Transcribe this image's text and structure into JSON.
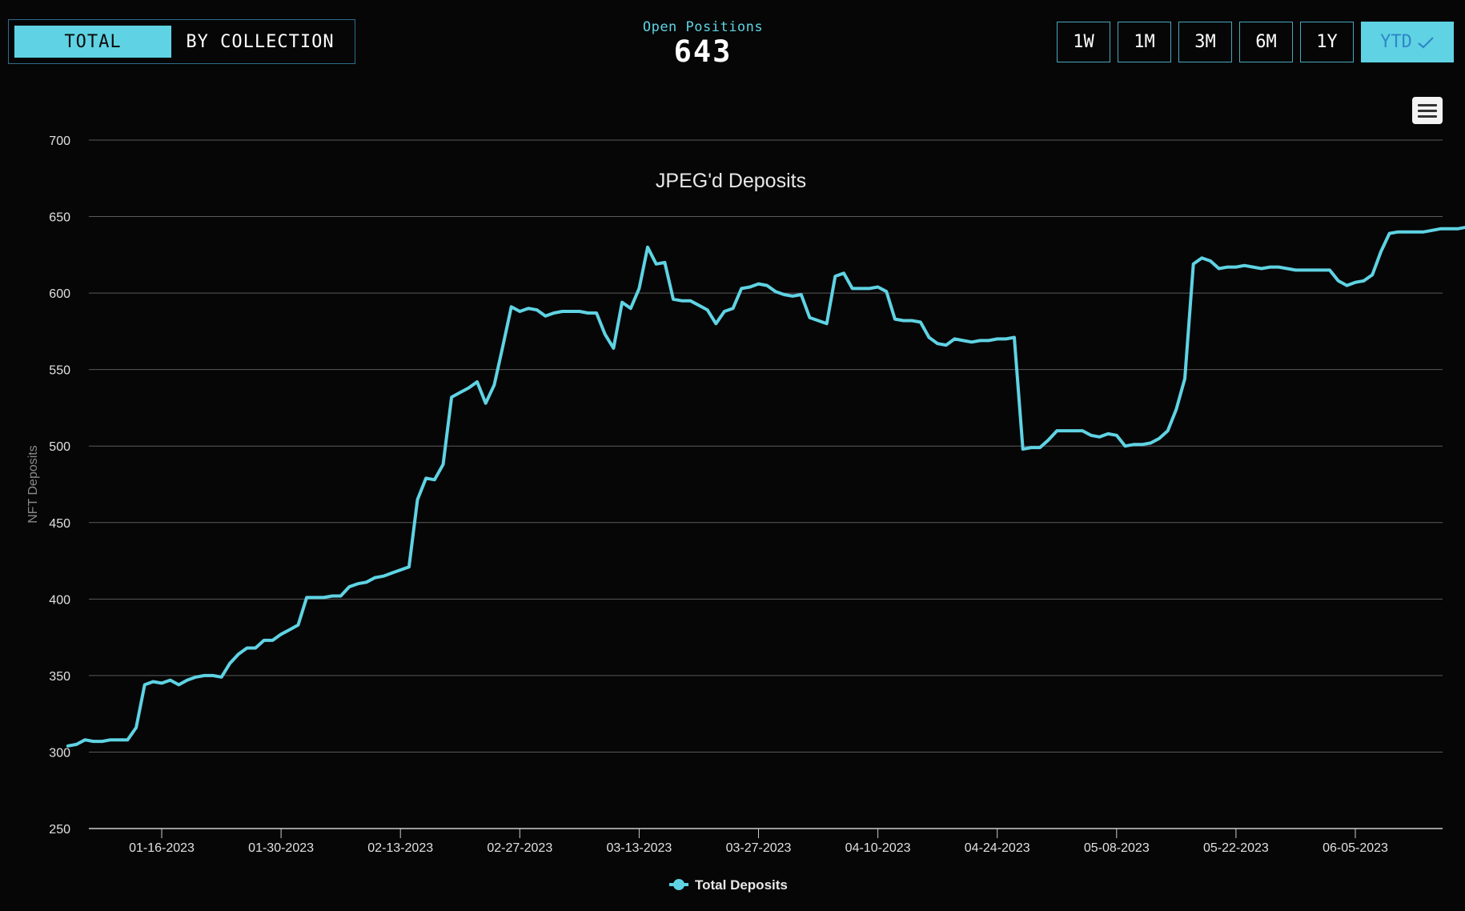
{
  "toggle": {
    "total": "TOTAL",
    "by_collection": "BY COLLECTION",
    "active": "total"
  },
  "stat": {
    "label": "Open Positions",
    "value": "643"
  },
  "ranges": [
    {
      "label": "1W",
      "active": false
    },
    {
      "label": "1M",
      "active": false
    },
    {
      "label": "3M",
      "active": false
    },
    {
      "label": "6M",
      "active": false
    },
    {
      "label": "1Y",
      "active": false
    },
    {
      "label": "YTD",
      "active": true
    }
  ],
  "icons": {
    "check": "check-icon",
    "menu": "hamburger-menu-icon",
    "legend_marker": "circle-marker-icon"
  },
  "colors": {
    "accent": "#5fd3e3",
    "background": "#060607",
    "grid": "#5a5a5a"
  },
  "chart_data": {
    "type": "line",
    "title": "JPEG'd Deposits",
    "xlabel": "",
    "ylabel": "NFT Deposits",
    "ylim": [
      250,
      700
    ],
    "yticks": [
      250,
      300,
      350,
      400,
      450,
      500,
      550,
      600,
      650,
      700
    ],
    "xticks": [
      "01-16-2023",
      "01-30-2023",
      "02-13-2023",
      "02-27-2023",
      "03-13-2023",
      "03-27-2023",
      "04-10-2023",
      "04-24-2023",
      "05-08-2023",
      "05-22-2023",
      "06-05-2023"
    ],
    "grid": true,
    "legend_position": "bottom-center",
    "series": [
      {
        "name": "Total Deposits",
        "color": "#5fd3e3",
        "points": [
          [
            "01-05-2023",
            304
          ],
          [
            "01-06-2023",
            305
          ],
          [
            "01-07-2023",
            308
          ],
          [
            "01-08-2023",
            307
          ],
          [
            "01-09-2023",
            307
          ],
          [
            "01-10-2023",
            308
          ],
          [
            "01-11-2023",
            308
          ],
          [
            "01-12-2023",
            308
          ],
          [
            "01-13-2023",
            316
          ],
          [
            "01-14-2023",
            344
          ],
          [
            "01-15-2023",
            346
          ],
          [
            "01-16-2023",
            345
          ],
          [
            "01-17-2023",
            347
          ],
          [
            "01-18-2023",
            344
          ],
          [
            "01-19-2023",
            347
          ],
          [
            "01-20-2023",
            349
          ],
          [
            "01-21-2023",
            350
          ],
          [
            "01-22-2023",
            350
          ],
          [
            "01-23-2023",
            349
          ],
          [
            "01-24-2023",
            358
          ],
          [
            "01-25-2023",
            364
          ],
          [
            "01-26-2023",
            368
          ],
          [
            "01-27-2023",
            368
          ],
          [
            "01-28-2023",
            373
          ],
          [
            "01-29-2023",
            373
          ],
          [
            "01-30-2023",
            377
          ],
          [
            "01-31-2023",
            380
          ],
          [
            "02-01-2023",
            383
          ],
          [
            "02-02-2023",
            401
          ],
          [
            "02-03-2023",
            401
          ],
          [
            "02-04-2023",
            401
          ],
          [
            "02-05-2023",
            402
          ],
          [
            "02-06-2023",
            402
          ],
          [
            "02-07-2023",
            408
          ],
          [
            "02-08-2023",
            410
          ],
          [
            "02-09-2023",
            411
          ],
          [
            "02-10-2023",
            414
          ],
          [
            "02-11-2023",
            415
          ],
          [
            "02-12-2023",
            417
          ],
          [
            "02-13-2023",
            419
          ],
          [
            "02-14-2023",
            421
          ],
          [
            "02-15-2023",
            465
          ],
          [
            "02-16-2023",
            479
          ],
          [
            "02-17-2023",
            478
          ],
          [
            "02-18-2023",
            488
          ],
          [
            "02-19-2023",
            532
          ],
          [
            "02-20-2023",
            535
          ],
          [
            "02-21-2023",
            538
          ],
          [
            "02-22-2023",
            542
          ],
          [
            "02-23-2023",
            528
          ],
          [
            "02-24-2023",
            540
          ],
          [
            "02-25-2023",
            565
          ],
          [
            "02-26-2023",
            591
          ],
          [
            "02-27-2023",
            588
          ],
          [
            "02-28-2023",
            590
          ],
          [
            "03-01-2023",
            589
          ],
          [
            "03-02-2023",
            585
          ],
          [
            "03-03-2023",
            587
          ],
          [
            "03-04-2023",
            588
          ],
          [
            "03-05-2023",
            588
          ],
          [
            "03-06-2023",
            588
          ],
          [
            "03-07-2023",
            587
          ],
          [
            "03-08-2023",
            587
          ],
          [
            "03-09-2023",
            573
          ],
          [
            "03-10-2023",
            564
          ],
          [
            "03-11-2023",
            594
          ],
          [
            "03-12-2023",
            590
          ],
          [
            "03-13-2023",
            603
          ],
          [
            "03-14-2023",
            630
          ],
          [
            "03-15-2023",
            619
          ],
          [
            "03-16-2023",
            620
          ],
          [
            "03-17-2023",
            596
          ],
          [
            "03-18-2023",
            595
          ],
          [
            "03-19-2023",
            595
          ],
          [
            "03-20-2023",
            592
          ],
          [
            "03-21-2023",
            589
          ],
          [
            "03-22-2023",
            580
          ],
          [
            "03-23-2023",
            588
          ],
          [
            "03-24-2023",
            590
          ],
          [
            "03-25-2023",
            603
          ],
          [
            "03-26-2023",
            604
          ],
          [
            "03-27-2023",
            606
          ],
          [
            "03-28-2023",
            605
          ],
          [
            "03-29-2023",
            601
          ],
          [
            "03-30-2023",
            599
          ],
          [
            "03-31-2023",
            598
          ],
          [
            "04-01-2023",
            599
          ],
          [
            "04-02-2023",
            584
          ],
          [
            "04-03-2023",
            582
          ],
          [
            "04-04-2023",
            580
          ],
          [
            "04-05-2023",
            611
          ],
          [
            "04-06-2023",
            613
          ],
          [
            "04-07-2023",
            603
          ],
          [
            "04-08-2023",
            603
          ],
          [
            "04-09-2023",
            603
          ],
          [
            "04-10-2023",
            604
          ],
          [
            "04-11-2023",
            601
          ],
          [
            "04-12-2023",
            583
          ],
          [
            "04-13-2023",
            582
          ],
          [
            "04-14-2023",
            582
          ],
          [
            "04-15-2023",
            581
          ],
          [
            "04-16-2023",
            571
          ],
          [
            "04-17-2023",
            567
          ],
          [
            "04-18-2023",
            566
          ],
          [
            "04-19-2023",
            570
          ],
          [
            "04-20-2023",
            569
          ],
          [
            "04-21-2023",
            568
          ],
          [
            "04-22-2023",
            569
          ],
          [
            "04-23-2023",
            569
          ],
          [
            "04-24-2023",
            570
          ],
          [
            "04-25-2023",
            570
          ],
          [
            "04-26-2023",
            571
          ],
          [
            "04-27-2023",
            498
          ],
          [
            "04-28-2023",
            499
          ],
          [
            "04-29-2023",
            499
          ],
          [
            "04-30-2023",
            504
          ],
          [
            "05-01-2023",
            510
          ],
          [
            "05-02-2023",
            510
          ],
          [
            "05-03-2023",
            510
          ],
          [
            "05-04-2023",
            510
          ],
          [
            "05-05-2023",
            507
          ],
          [
            "05-06-2023",
            506
          ],
          [
            "05-07-2023",
            508
          ],
          [
            "05-08-2023",
            507
          ],
          [
            "05-09-2023",
            500
          ],
          [
            "05-10-2023",
            501
          ],
          [
            "05-11-2023",
            501
          ],
          [
            "05-12-2023",
            502
          ],
          [
            "05-13-2023",
            505
          ],
          [
            "05-14-2023",
            510
          ],
          [
            "05-15-2023",
            524
          ],
          [
            "05-16-2023",
            544
          ],
          [
            "05-17-2023",
            619
          ],
          [
            "05-18-2023",
            623
          ],
          [
            "05-19-2023",
            621
          ],
          [
            "05-20-2023",
            616
          ],
          [
            "05-21-2023",
            617
          ],
          [
            "05-22-2023",
            617
          ],
          [
            "05-23-2023",
            618
          ],
          [
            "05-24-2023",
            617
          ],
          [
            "05-25-2023",
            616
          ],
          [
            "05-26-2023",
            617
          ],
          [
            "05-27-2023",
            617
          ],
          [
            "05-28-2023",
            616
          ],
          [
            "05-29-2023",
            615
          ],
          [
            "05-30-2023",
            615
          ],
          [
            "05-31-2023",
            615
          ],
          [
            "06-01-2023",
            615
          ],
          [
            "06-02-2023",
            615
          ],
          [
            "06-03-2023",
            608
          ],
          [
            "06-04-2023",
            605
          ],
          [
            "06-05-2023",
            607
          ],
          [
            "06-06-2023",
            608
          ],
          [
            "06-07-2023",
            612
          ],
          [
            "06-08-2023",
            627
          ],
          [
            "06-09-2023",
            639
          ],
          [
            "06-10-2023",
            640
          ],
          [
            "06-11-2023",
            640
          ],
          [
            "06-12-2023",
            640
          ],
          [
            "06-13-2023",
            640
          ],
          [
            "06-14-2023",
            641
          ],
          [
            "06-15-2023",
            642
          ],
          [
            "06-16-2023",
            642
          ],
          [
            "06-17-2023",
            642
          ],
          [
            "06-18-2023",
            643
          ],
          [
            "06-19-2023",
            643
          ]
        ]
      }
    ]
  }
}
